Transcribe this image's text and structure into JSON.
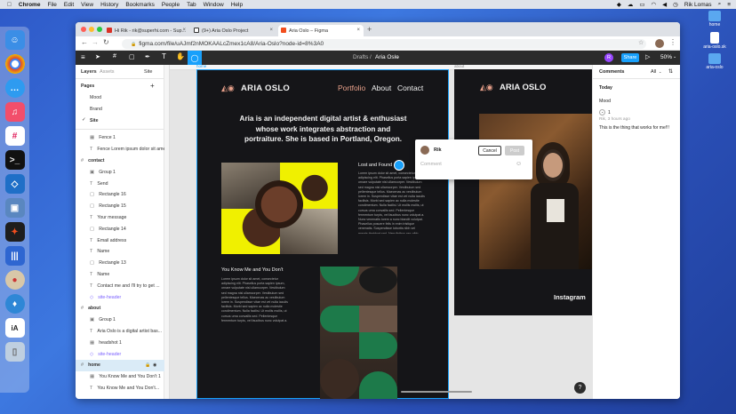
{
  "menubar": {
    "app": "Chrome",
    "items": [
      "File",
      "Edit",
      "View",
      "History",
      "Bookmarks",
      "People",
      "Tab",
      "Window",
      "Help"
    ],
    "user": "Rik Lomas"
  },
  "desktop": {
    "icons": [
      "home",
      "aria-oslo.sk",
      "aria-oslo"
    ]
  },
  "browser": {
    "tabs": [
      {
        "label": "Hi Rik - rik@superhi.com - Sup..."
      },
      {
        "label": "(9+) Aria Oslo Project"
      },
      {
        "label": "Aria Oslo – Figma"
      }
    ],
    "url": "figma.com/file/uAJmf2nMOKAALcZmex1cA8/Aria-Oslo?node-id=8%3A0"
  },
  "toolbar": {
    "drafts": "Drafts",
    "slash": "/",
    "file": "Aria Oslo",
    "avatar": "R",
    "share": "Share",
    "zoom": "50%"
  },
  "left": {
    "tabs": {
      "layers": "Layers",
      "assets": "Assets",
      "page": "Site"
    },
    "pages_title": "Pages",
    "pages": [
      "Mood",
      "Brand",
      "Site"
    ],
    "layers": [
      {
        "name": "Fence 1",
        "type": "img"
      },
      {
        "name": "Fence Lorem ipsum dolor sit amet,...",
        "type": "text"
      },
      {
        "name": "contact",
        "type": "frame"
      },
      {
        "name": "Group 1",
        "type": "group"
      },
      {
        "name": "Send",
        "type": "text"
      },
      {
        "name": "Rectangle 16",
        "type": "rect"
      },
      {
        "name": "Rectangle 15",
        "type": "rect"
      },
      {
        "name": "Your message",
        "type": "text"
      },
      {
        "name": "Rectangle 14",
        "type": "rect"
      },
      {
        "name": "Email address",
        "type": "text"
      },
      {
        "name": "Name",
        "type": "text"
      },
      {
        "name": "Rectangle 13",
        "type": "rect"
      },
      {
        "name": "Name",
        "type": "text"
      },
      {
        "name": "Contact me and I'll try to get ...",
        "type": "text"
      },
      {
        "name": "site-header",
        "type": "comp"
      },
      {
        "name": "about",
        "type": "frame"
      },
      {
        "name": "Group 1",
        "type": "group"
      },
      {
        "name": "Aria Oslo is a digital artist bas...",
        "type": "text"
      },
      {
        "name": "headshot 1",
        "type": "img"
      },
      {
        "name": "site-header",
        "type": "comp"
      },
      {
        "name": "home",
        "type": "frame"
      },
      {
        "name": "You Know Me and You Don't 1",
        "type": "img"
      },
      {
        "name": "You Know Me and You Don't...",
        "type": "text"
      }
    ]
  },
  "canvas": {
    "frame_home_label": "home",
    "frame_about_label": "about",
    "logo": "ARIA OSLO",
    "nav": [
      "Portfolio",
      "About",
      "Contact"
    ],
    "intro": "Aria is an independent digital artist & enthusiast whose work integrates abstraction and portraiture. She is based in Portland, Oregon.",
    "section1_title": "Lost and Found",
    "section1_body": "Lorem ipsum dolor sit amet, consectetur adipiscing elit. Phasellus porta sapien ipsum, ornare vulputate nisl ullamcorper. Vestibulum sed magna nisl ullamcorper. Vestibulum sed pellentesque tellus. Maecenas ac vestibulum lorem in. Suspendisse vitae est vel nulla iaculis facilisis. Morbi sed sapien ac nulla molestie condimentum. Nulla facilisi. Ut mollis mollis, ut cursus urna convallis sed. Pellentesque fermentum turpis, vel faucibus nunc volutpat a. Nunc venenatis lorem a nunc blandit volutpat. Phasellus posuere felis in enim tristique venenatis. Suspendisse lobortis nibh vel mauris tincidunt sed. Nam finibus nec nibh.",
    "section2_title": "You Know Me and You Don't",
    "section2_body": "Lorem ipsum dolor sit amet, consectetur adipiscing elit. Phasellus porta sapien ipsum, ornare vulputate nisl ullamcorper. Vestibulum sed magna nisl ullamcorper. Vestibulum sed pellentesque tellus. Maecenas ac vestibulum lorem in. Suspendisse vitae est vel nulla iaculis facilisis. Morbi sed sapien ac nulla molestie condimentum. Nulla facilisi. Ut mollis mollis, ut cursus urna convallis sed. Pellentesque fermentum turpis, vel faucibus nunc volutpat a.",
    "instagram": "Instagram",
    "comment_box": {
      "user": "Rik",
      "cancel": "Cancel",
      "post": "Post",
      "placeholder": "Comment"
    }
  },
  "right": {
    "title": "Comments",
    "filter": "All",
    "group": "Today",
    "page": "Mood",
    "number": "1",
    "meta": "Rik, 3 hours ago",
    "text": "This is the thing that works for me!!!"
  },
  "colors": {
    "figma_dark": "#2c2c2c",
    "accent": "#18a0fb",
    "frame_bg": "#151518",
    "yellow": "#f0f000",
    "green": "#1d7a4a",
    "salmon": "#e8a08a"
  }
}
